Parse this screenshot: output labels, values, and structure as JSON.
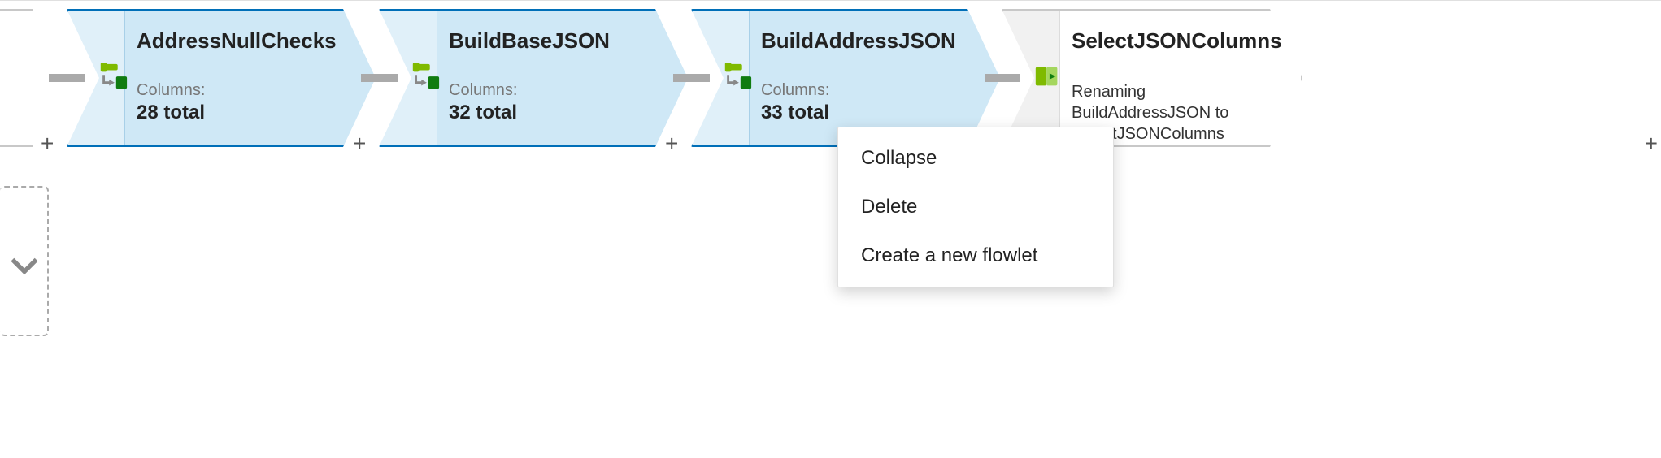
{
  "nodes": {
    "n1": {
      "title": "AddressNullChecks",
      "columns_label": "Columns:",
      "columns_value": "28 total"
    },
    "n2": {
      "title": "BuildBaseJSON",
      "columns_label": "Columns:",
      "columns_value": "32 total"
    },
    "n3": {
      "title": "BuildAddressJSON",
      "columns_label": "Columns:",
      "columns_value": "33 total"
    },
    "n4": {
      "title": "SelectJSONColumns",
      "description": "Renaming BuildAddressJSON to SelectJSONColumns with columns 'identifier, address,"
    }
  },
  "buttons": {
    "plus": "+"
  },
  "context_menu": {
    "items": {
      "collapse": "Collapse",
      "delete": "Delete",
      "new_flowlet": "Create a new flowlet"
    }
  },
  "icons": {
    "derived_column": "derived-column-icon",
    "select": "select-icon",
    "chevron_down": "chevron-down-icon"
  }
}
